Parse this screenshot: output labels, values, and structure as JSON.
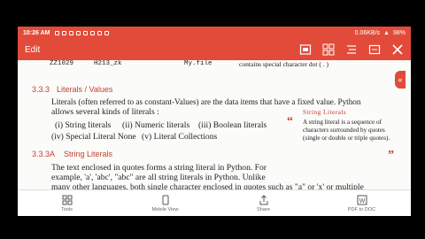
{
  "statusbar": {
    "time": "10:26 AM",
    "right_text": "0.06KB/s",
    "battery": "98%"
  },
  "toolbar": {
    "title": "Edit"
  },
  "doc": {
    "top_line_1": "ZZ1029",
    "top_line_2": "H213_zk",
    "top_line_3": "My.file",
    "top_line_4": "contains special character dot ( . )",
    "section": "3.3.3",
    "heading": "Literals / Values",
    "p1a": "Literals (often referred to as constant-Values) are the data items that have a fixed value. Python",
    "p1b": "allows several kinds of literals :",
    "l1": "(i) String literals",
    "l2": "(ii) Numeric literals",
    "l3": "(iii) Boolean literals",
    "l4": "(iv) Special Literal None",
    "l5": "(v) Literal Collections",
    "sub_section": "3.3.3A",
    "sub_heading": "String Literals",
    "p2a": "The text enclosed in quotes forms a string literal in Python. For",
    "p2b": "example, 'a', 'abc', \"abc\" are all string literals in Python. Unlike",
    "p2c": "many other languages, both single character enclosed in quotes such as \"a\" or 'x' or multiple",
    "box_title": "String Literals",
    "box_body": "A string literal is a sequence of characters surrounded by quotes (single or double or triple quotes).",
    "open_quote": "“",
    "close_quote": "”"
  },
  "fab": {
    "label": "«"
  },
  "bottombar": {
    "items": [
      {
        "label": "Tools",
        "icon": "tools-icon"
      },
      {
        "label": "Mobile View",
        "icon": "mobile-view-icon"
      },
      {
        "label": "Share",
        "icon": "share-icon"
      },
      {
        "label": "PDF to DOC",
        "icon": "pdf-to-doc-icon"
      }
    ]
  }
}
